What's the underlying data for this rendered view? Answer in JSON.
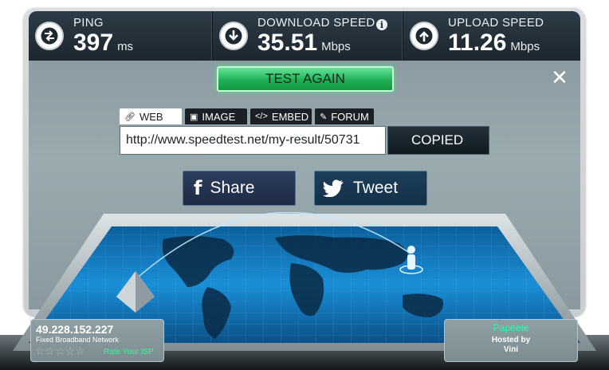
{
  "stats": {
    "ping": {
      "label": "PING",
      "value": "397",
      "unit": "ms",
      "icon": "exchange-arrows-icon"
    },
    "download": {
      "label": "DOWNLOAD SPEED",
      "value": "35.51",
      "unit": "Mbps",
      "icon": "arrow-down-icon",
      "info": "i"
    },
    "upload": {
      "label": "UPLOAD SPEED",
      "value": "11.26",
      "unit": "Mbps",
      "icon": "arrow-up-icon"
    }
  },
  "actions": {
    "test_again": "TEST AGAIN",
    "close": "✕"
  },
  "share_tabs": [
    {
      "label": "WEB",
      "icon": "link-icon",
      "active": true
    },
    {
      "label": "IMAGE",
      "icon": "image-icon",
      "active": false
    },
    {
      "label": "EMBED",
      "icon": "code-icon",
      "active": false
    },
    {
      "label": "FORUM",
      "icon": "edit-icon",
      "active": false
    }
  ],
  "result": {
    "url": "http://www.speedtest.net/my-result/50731",
    "copy_label": "COPIED"
  },
  "social": {
    "share": "Share",
    "tweet": "Tweet"
  },
  "client": {
    "ip": "49.228.152.227",
    "isp": "Fixed Broadband Network",
    "rating_stars": 5,
    "rate_label": "Rate Your ISP"
  },
  "server": {
    "city": "Papeete",
    "hosted_by": "Hosted by",
    "host": "Vini"
  },
  "colors": {
    "accent_green": "#1fb057",
    "stats_bg": "#1c262e",
    "panel_bg": "#8b9ba1",
    "map_blue": "#1a8fd8",
    "host_city": "#26ffb0"
  }
}
